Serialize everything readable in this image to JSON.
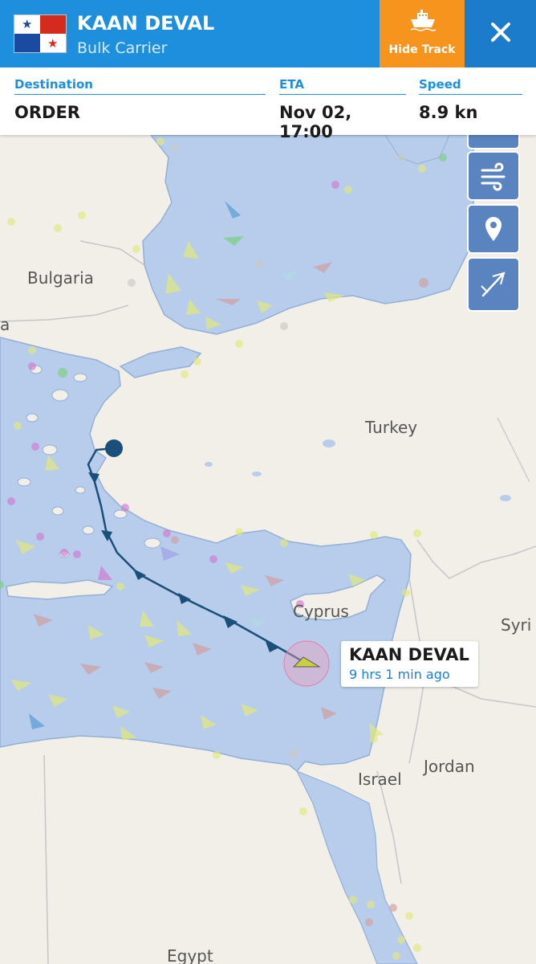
{
  "vessel": {
    "name": "KAAN DEVAL",
    "type": "Bulk Carrier",
    "flag_colors": {
      "red": "#d52b1e",
      "blue": "#1a4ba0"
    }
  },
  "header": {
    "hide_track_label": "Hide Track",
    "hide_track_icon": "ship-icon",
    "close_icon": "close-icon",
    "bg_color": "#1e8fdc",
    "accent_color": "#f7941d"
  },
  "info": {
    "destination_label": "Destination",
    "destination_value": "ORDER",
    "eta_label": "ETA",
    "eta_value": "Nov 02, 17:00",
    "speed_label": "Speed",
    "speed_value": "8.9 kn"
  },
  "map": {
    "countries": {
      "bulgaria": "Bulgaria",
      "turkey": "Turkey",
      "cyprus": "Cyprus",
      "syria": "Syri",
      "jordan": "Jordan",
      "israel": "Israel",
      "egypt": "Egypt",
      "partial": "a"
    },
    "controls": [
      "layers-icon",
      "wind-icon",
      "location-pin-icon",
      "measure-icon"
    ],
    "sea_color": "#b7cdeb",
    "land_color": "#f2efe9",
    "track_color": "#1b4f7a"
  },
  "vessel_label": {
    "name": "KAAN DEVAL",
    "time_ago": "9 hrs 1 min ago"
  }
}
